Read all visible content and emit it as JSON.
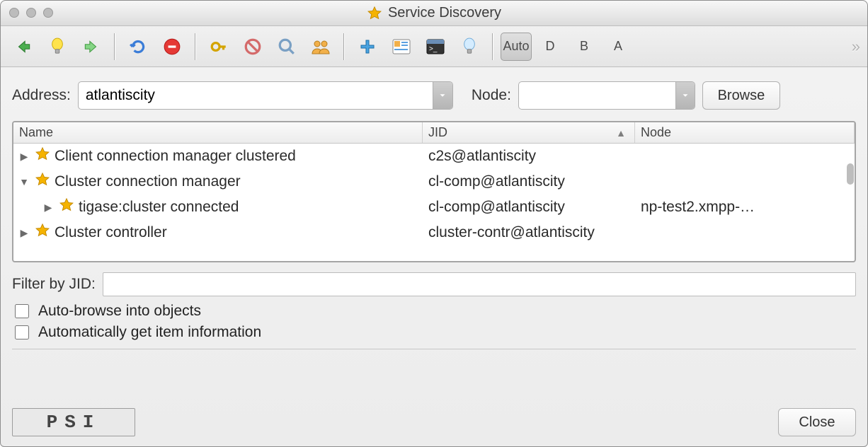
{
  "window": {
    "title": "Service Discovery"
  },
  "toolbar": {
    "auto_label": "Auto",
    "d_label": "D",
    "b_label": "B",
    "a_label": "A"
  },
  "address": {
    "label": "Address:",
    "value": "atlantiscity",
    "node_label": "Node:",
    "node_value": "",
    "browse_label": "Browse"
  },
  "columns": {
    "name": "Name",
    "jid": "JID",
    "node": "Node"
  },
  "rows": [
    {
      "indent": 0,
      "expanded": false,
      "name": "Client connection manager clustered",
      "jid": "c2s@atlantiscity",
      "node": ""
    },
    {
      "indent": 0,
      "expanded": true,
      "name": "Cluster connection manager",
      "jid": "cl-comp@atlantiscity",
      "node": ""
    },
    {
      "indent": 1,
      "expanded": false,
      "name": "tigase:cluster connected",
      "jid": "cl-comp@atlantiscity",
      "node": "np-test2.xmpp-…"
    },
    {
      "indent": 0,
      "expanded": false,
      "name": "Cluster controller",
      "jid": "cluster-contr@atlantiscity",
      "node": ""
    }
  ],
  "filter": {
    "label": "Filter by JID:",
    "value": ""
  },
  "options": {
    "auto_browse": "Auto-browse into objects",
    "auto_info": "Automatically get item information"
  },
  "footer": {
    "close_label": "Close",
    "logo_text": "PSI"
  }
}
